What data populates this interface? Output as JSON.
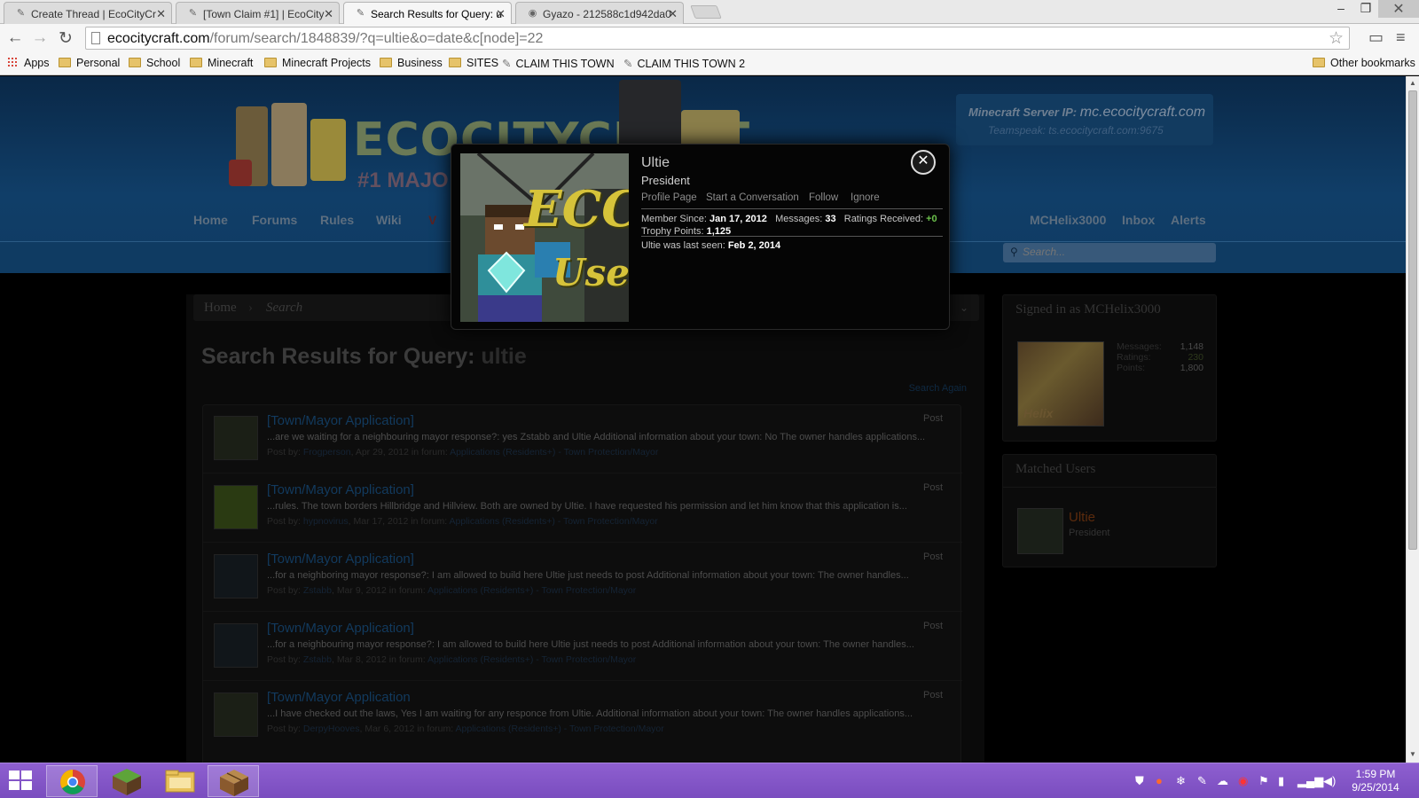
{
  "browser": {
    "tabs": [
      {
        "title": "Create Thread | EcoCityCr",
        "active": false
      },
      {
        "title": "[Town Claim #1] | EcoCity",
        "active": false
      },
      {
        "title": "Search Results for Query: u",
        "active": true
      },
      {
        "title": "Gyazo - 212588c1d942da0",
        "active": false
      }
    ],
    "url_domain": "ecocitycraft.com",
    "url_path": "/forum/search/1848839/?q=ultie&o=date&c[node]=22",
    "bookmarks": [
      {
        "label": "Apps",
        "icon": "apps-grid-icon"
      },
      {
        "label": "Personal",
        "icon": "folder-icon"
      },
      {
        "label": "School",
        "icon": "folder-icon"
      },
      {
        "label": "Minecraft",
        "icon": "folder-icon"
      },
      {
        "label": "Minecraft Projects",
        "icon": "folder-icon"
      },
      {
        "label": "Business",
        "icon": "folder-icon"
      },
      {
        "label": "SITES",
        "icon": "folder-icon"
      },
      {
        "label": "CLAIM THIS TOWN",
        "icon": "site-favicon"
      },
      {
        "label": "CLAIM THIS TOWN 2",
        "icon": "site-favicon"
      }
    ],
    "other_bookmarks": "Other bookmarks"
  },
  "site": {
    "logo_text": "ECOCITYCRAFT",
    "logo_tagline": "#1 MAJO",
    "server_ip_label": "Minecraft Server IP:",
    "server_ip": "mc.ecocitycraft.com",
    "teamspeak": "Teamspeak: ts.ecocitycraft.com:9675",
    "nav": [
      "Home",
      "Forums",
      "Rules",
      "Wiki",
      "V"
    ],
    "user_nav": [
      "MCHelix3000",
      "Inbox",
      "Alerts"
    ],
    "search_placeholder": "Search..."
  },
  "breadcrumb": [
    "Home",
    "Search"
  ],
  "page_title": "Search Results for Query:",
  "query": "ultie",
  "search_again": "Search Again",
  "results": [
    {
      "title": "[Town/Mayor Application]",
      "snippet": "...are we waiting for a neighbouring mayor response?: yes Zstabb and Ultie Additional information about your town: No The owner handles applications...",
      "author": "Frogperson",
      "date": "Apr 29, 2012",
      "forum": "Applications (Residents+) - Town Protection/Mayor",
      "type": "Post"
    },
    {
      "title": "[Town/Mayor Application]",
      "snippet": "...rules. The town borders Hillbridge and Hillview. Both are owned by Ultie. I have requested his permission and let him know that this application is...",
      "author": "hypnovirus",
      "date": "Mar 17, 2012",
      "forum": "Applications (Residents+) - Town Protection/Mayor",
      "type": "Post"
    },
    {
      "title": "[Town/Mayor Application]",
      "snippet": "...for a neighboring mayor response?: I am allowed to build here Ultie just needs to post Additional information about your town: The owner handles...",
      "author": "Zstabb",
      "date": "Mar 9, 2012",
      "forum": "Applications (Residents+) - Town Protection/Mayor",
      "type": "Post"
    },
    {
      "title": "[Town/Mayor Application]",
      "snippet": "...for a neighbouring mayor response?: I am allowed to build here Ultie just needs to post Additional information about your town: The owner handles...",
      "author": "Zstabb",
      "date": "Mar 8, 2012",
      "forum": "Applications (Residents+) - Town Protection/Mayor",
      "type": "Post"
    },
    {
      "title": "[Town/Mayor Application",
      "snippet": "...I have checked out the laws, Yes I am waiting for any responce from Ultie. Additional information about your town: The owner handles applications...",
      "author": "DerpyHooves",
      "date": "Mar 6, 2012",
      "forum": "Applications (Residents+) - Town Protection/Mayor",
      "type": "Post"
    }
  ],
  "sidebar": {
    "signed_in": "Signed in as MCHelix3000",
    "stats": [
      {
        "label": "Messages:",
        "value": "1,148"
      },
      {
        "label": "Ratings:",
        "value": "230"
      },
      {
        "label": "Points:",
        "value": "1,800"
      }
    ],
    "avatar_caption": "Helix",
    "matched_users_heading": "Matched Users",
    "matched_user": {
      "name": "Ultie",
      "role": "President"
    }
  },
  "member_card": {
    "name": "Ultie",
    "role": "President",
    "avatar_text_1": "ECC",
    "avatar_text_2": "User",
    "links": [
      "Profile Page",
      "Start a Conversation",
      "Follow",
      "Ignore"
    ],
    "member_since_label": "Member Since:",
    "member_since": "Jan 17, 2012",
    "messages_label": "Messages:",
    "messages": "33",
    "ratings_label": "Ratings Received:",
    "ratings": "+0",
    "trophy_label": "Trophy Points:",
    "trophy": "1,125",
    "last_seen_label": "Ultie was last seen:",
    "last_seen": "Feb 2, 2014"
  },
  "taskbar": {
    "time": "1:59 PM",
    "date": "9/25/2014",
    "apps": [
      "chrome-icon",
      "minecraft-grass-icon",
      "file-explorer-icon",
      "crafting-table-icon"
    ]
  },
  "colors": {
    "accent_link": "#123a5e",
    "card_green": "#6bc04b",
    "taskbar": "#8a5ccc"
  }
}
